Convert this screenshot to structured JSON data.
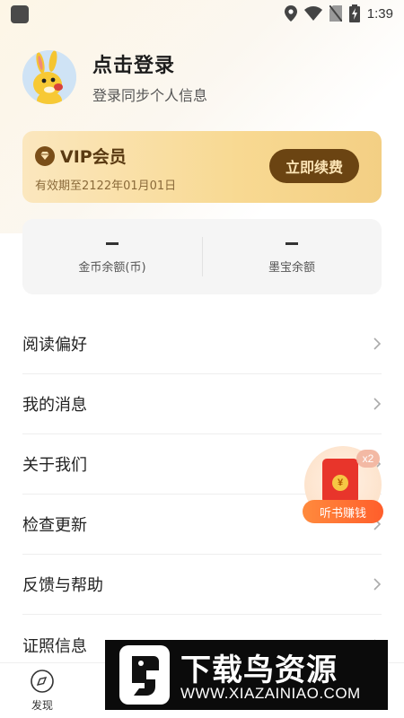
{
  "status_bar": {
    "time": "1:39"
  },
  "profile": {
    "title": "点击登录",
    "subtitle": "登录同步个人信息"
  },
  "vip": {
    "title": "VIP会员",
    "expiry": "有效期至2122年01月01日",
    "button_label": "立即续费"
  },
  "balances": [
    {
      "value": "–",
      "label": "金币余额(币)"
    },
    {
      "value": "–",
      "label": "墨宝余额"
    }
  ],
  "menu": {
    "items": [
      {
        "label": "阅读偏好"
      },
      {
        "label": "我的消息"
      },
      {
        "label": "关于我们"
      },
      {
        "label": "检查更新"
      },
      {
        "label": "反馈与帮助"
      },
      {
        "label": "证照信息"
      }
    ]
  },
  "float_reward": {
    "badge": "x2",
    "coin": "¥",
    "label": "听书赚钱"
  },
  "bottom_nav": {
    "tabs": [
      {
        "label": "发现",
        "icon": "compass-icon"
      }
    ]
  },
  "watermark": {
    "title": "下载鸟资源",
    "url": "WWW.XIAZAINIAO.COM"
  },
  "colors": {
    "vip_gradient_start": "#fbe7be",
    "vip_gradient_end": "#f3cf84",
    "vip_button": "#6b4412",
    "reward_label": "#ff5e2b"
  }
}
